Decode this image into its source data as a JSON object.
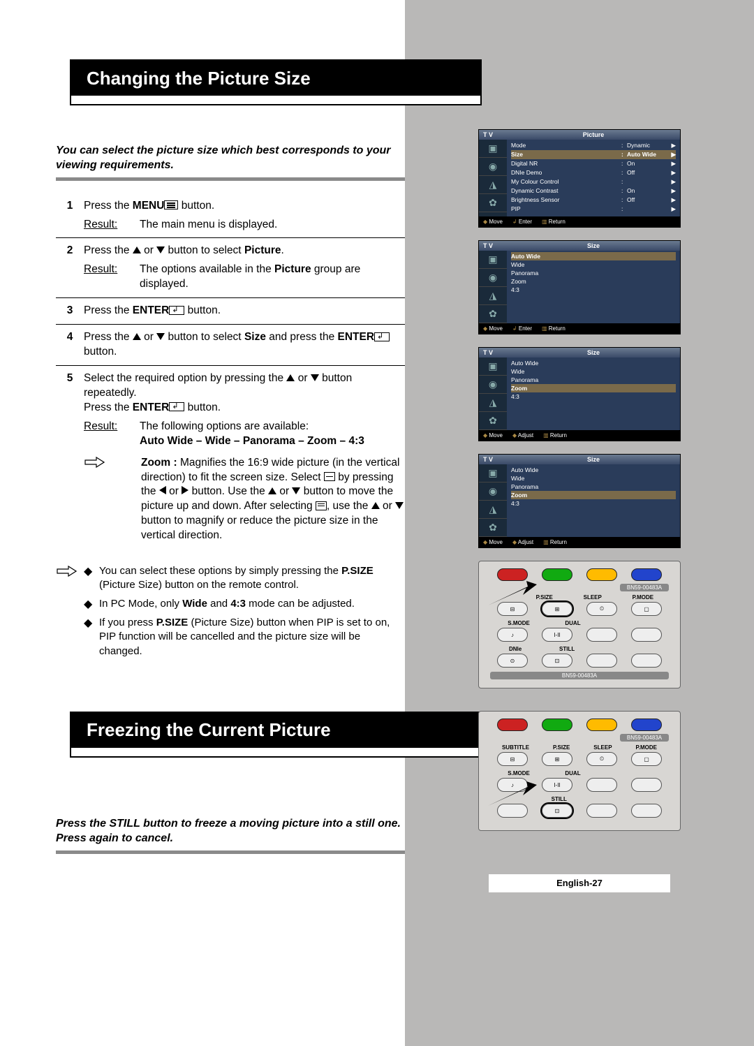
{
  "page_number": "English-27",
  "section1": {
    "title": "Changing the Picture Size",
    "intro": "You can select the picture size which best corresponds to your viewing requirements.",
    "steps": {
      "s1": {
        "num": "1",
        "text_a": "Press the ",
        "text_b": "MENU",
        "text_c": " button.",
        "result_label": "Result:",
        "result_text": "The main menu is displayed."
      },
      "s2": {
        "num": "2",
        "text_a": "Press the ",
        "text_b": " or ",
        "text_c": " button to select ",
        "text_d": "Picture",
        "text_e": ".",
        "result_label": "Result:",
        "result_text_a": "The options available in the ",
        "result_text_b": "Picture",
        "result_text_c": " group are displayed."
      },
      "s3": {
        "num": "3",
        "text_a": "Press the ",
        "text_b": "ENTER",
        "text_c": " button."
      },
      "s4": {
        "num": "4",
        "text_a": "Press the ",
        "text_b": " or ",
        "text_c": " button to select ",
        "text_d": "Size",
        "text_e": " and press the ",
        "text_f": "ENTER",
        "text_g": " button."
      },
      "s5": {
        "num": "5",
        "text_a": "Select the required option by pressing the ",
        "text_b": " or ",
        "text_c": " button repeatedly.",
        "text_d": "Press the ",
        "text_e": "ENTER",
        "text_f": " button.",
        "result_label": "Result:",
        "result_text": "The following options are available:",
        "options": "Auto Wide – Wide – Panorama – Zoom – 4:3",
        "zoom_label": "Zoom :",
        "zoom_a": " Magnifies the 16:9 wide picture (in the vertical direction) to fit the screen size. Select ",
        "zoom_b": " by pressing the ",
        "zoom_c": " or ",
        "zoom_d": " button. Use the ",
        "zoom_e": " or ",
        "zoom_f": " button to move the picture up and down. After selecting ",
        "zoom_g": ", use the ",
        "zoom_h": " or ",
        "zoom_i": " button to magnify or reduce the picture size in the vertical direction."
      }
    },
    "notes": {
      "n1_a": "You can select these options by simply pressing the ",
      "n1_b": "P.SIZE",
      "n1_c": " (Picture Size) button on the remote control.",
      "n2_a": "In PC Mode, only ",
      "n2_b": "Wide",
      "n2_c": " and ",
      "n2_d": "4:3",
      "n2_e": " mode can be adjusted.",
      "n3_a": "If you press ",
      "n3_b": "P.SIZE",
      "n3_c": " (Picture Size) button when PIP is set to on, PIP function will be cancelled and the picture size will be changed."
    }
  },
  "section2": {
    "title": "Freezing the Current Picture",
    "intro": "Press the STILL button to freeze a moving picture into a still one. Press again to cancel."
  },
  "osd": {
    "tv": "T V",
    "picture_menu": {
      "title": "Picture",
      "rows": [
        {
          "k": "Mode",
          "v": "Dynamic"
        },
        {
          "k": "Size",
          "v": "Auto Wide",
          "hl": true
        },
        {
          "k": "Digital NR",
          "v": "On"
        },
        {
          "k": "DNIe Demo",
          "v": "Off"
        },
        {
          "k": "My Colour Control",
          "v": ""
        },
        {
          "k": "Dynamic Contrast",
          "v": "On"
        },
        {
          "k": "Brightness Sensor",
          "v": "Off"
        },
        {
          "k": "PIP",
          "v": ""
        }
      ],
      "foot": {
        "move": "Move",
        "enter": "Enter",
        "return": "Return"
      }
    },
    "size_menu_1": {
      "title": "Size",
      "rows": [
        {
          "k": "Auto Wide",
          "hl": true
        },
        {
          "k": "Wide"
        },
        {
          "k": "Panorama"
        },
        {
          "k": "Zoom"
        },
        {
          "k": "4:3"
        }
      ],
      "foot": {
        "move": "Move",
        "enter": "Enter",
        "return": "Return"
      }
    },
    "size_menu_2": {
      "title": "Size",
      "rows": [
        {
          "k": "Auto Wide"
        },
        {
          "k": "Wide"
        },
        {
          "k": "Panorama"
        },
        {
          "k": "Zoom",
          "hl": true
        },
        {
          "k": "4:3"
        }
      ],
      "foot": {
        "move": "Move",
        "adjust": "Adjust",
        "return": "Return"
      }
    },
    "size_menu_3": {
      "title": "Size",
      "rows": [
        {
          "k": "Auto Wide"
        },
        {
          "k": "Wide"
        },
        {
          "k": "Panorama"
        },
        {
          "k": "Zoom",
          "hl": true
        },
        {
          "k": "4:3"
        }
      ],
      "foot": {
        "move": "Move",
        "adjust": "Adjust",
        "return": "Return"
      }
    }
  },
  "remote": {
    "model": "BN59-00483A",
    "labels_row1": [
      "",
      "P.SIZE",
      "SLEEP",
      "P.MODE"
    ],
    "labels_row2": [
      "S.MODE",
      "DUAL",
      "",
      ""
    ],
    "labels_row3": [
      "DNIe",
      "STILL",
      "",
      ""
    ],
    "labels2_row1": [
      "SUBTITLE",
      "P.SIZE",
      "SLEEP",
      "P.MODE"
    ],
    "labels2_row2": [
      "S.MODE",
      "DUAL",
      "",
      ""
    ],
    "labels2_row3": [
      "",
      "STILL",
      "",
      ""
    ],
    "btn_text": {
      "dual": "I-II",
      "psize": "⊞",
      "sleep": "⏲",
      "pmode": "▢",
      "dnie": "⊙",
      "still": "⊡",
      "smode": "♪",
      "subtitle": "⊟"
    }
  }
}
